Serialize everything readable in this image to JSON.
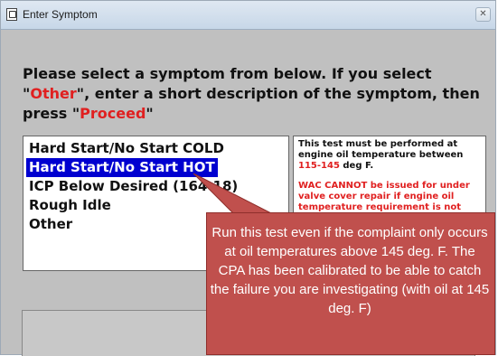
{
  "window": {
    "title": "Enter Symptom",
    "close_glyph": "✕"
  },
  "instruction": {
    "part1": "Please select a symptom from below. If you select \"",
    "other": "Other",
    "part2": "\", enter a short description of the symptom, then press \"",
    "proceed": "Proceed",
    "part3": "\""
  },
  "symptoms": [
    {
      "label": "Hard Start/No Start COLD",
      "selected": false
    },
    {
      "label": "Hard Start/No Start HOT",
      "selected": true
    },
    {
      "label": "ICP Below Desired (164-18)",
      "selected": false
    },
    {
      "label": "Rough Idle",
      "selected": false
    },
    {
      "label": "Other",
      "selected": false
    }
  ],
  "note": {
    "line1a": "This test must be performed at engine oil temperature between ",
    "temp_range": "115-145",
    "line1b": " deg F.",
    "warning": "WAC CANNOT be issued for under valve cover repair if engine oil temperature requirement is not met."
  },
  "callout": {
    "text": "Run this test even if the complaint only occurs at oil temperatures above 145 deg. F.  The CPA has been calibrated to be able to catch the failure you are investigating (with oil at 145 deg. F)"
  },
  "colors": {
    "callout_fill": "#c0504d",
    "selection": "#0000d0",
    "highlight_red": "#e02020"
  }
}
